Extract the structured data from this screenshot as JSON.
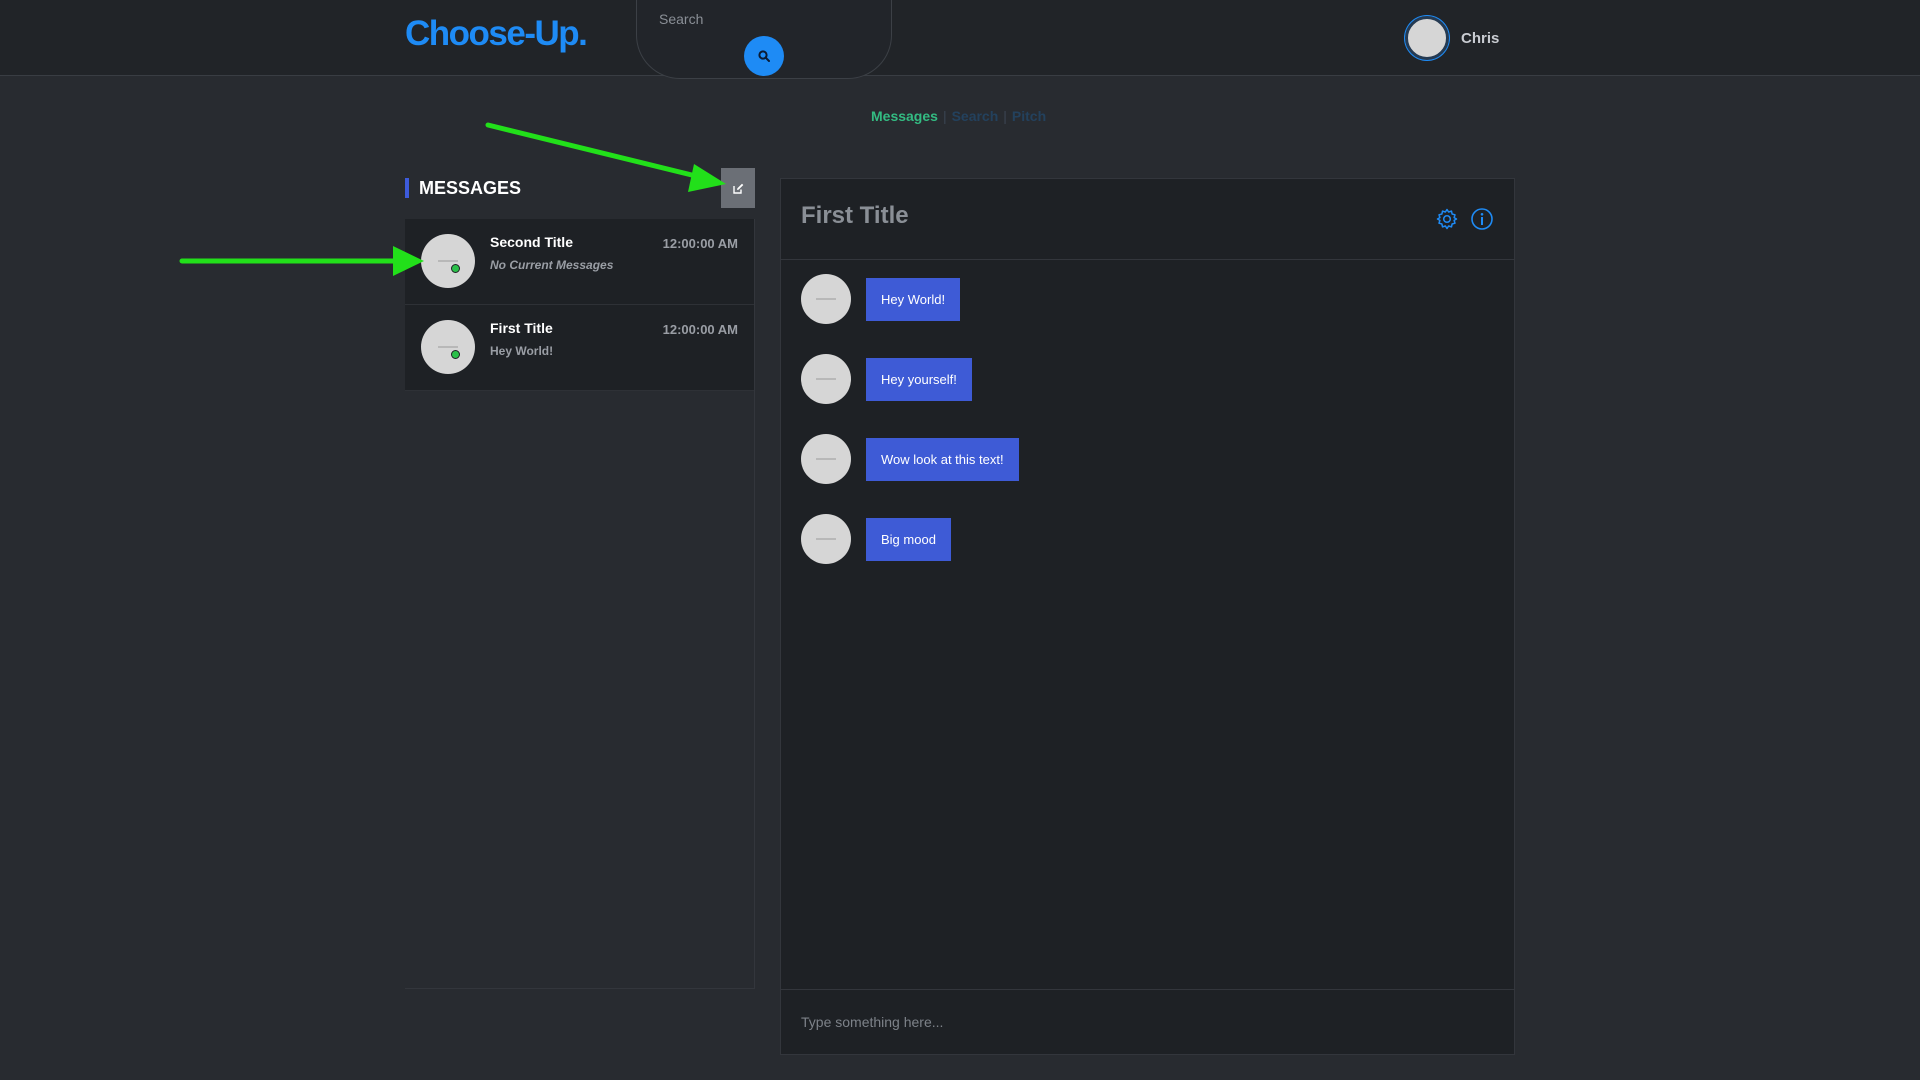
{
  "header": {
    "logo": "Choose-Up.",
    "search": {
      "placeholder": "Search",
      "icon": "search-icon"
    },
    "user": {
      "name": "Chris"
    }
  },
  "subnav": {
    "items": [
      {
        "label": "Messages",
        "active": true
      },
      {
        "label": "Search",
        "active": false
      },
      {
        "label": "Pitch",
        "active": false
      }
    ]
  },
  "messages_panel": {
    "heading": "MESSAGES",
    "compose_icon": "edit-icon",
    "conversations": [
      {
        "title": "Second Title",
        "preview": "No Current Messages",
        "time": "12:00:00 AM",
        "online": true
      },
      {
        "title": "First Title",
        "preview": "Hey World!",
        "time": "12:00:00 AM",
        "online": true
      }
    ]
  },
  "chat": {
    "title": "First Title",
    "icons": [
      "gear-icon",
      "info-icon"
    ],
    "messages": [
      {
        "text": "Hey World!"
      },
      {
        "text": "Hey yourself!"
      },
      {
        "text": "Wow look at this text!"
      },
      {
        "text": "Big mood"
      }
    ],
    "composer_placeholder": "Type something here..."
  },
  "colors": {
    "brand": "#1e8bf5",
    "active_nav": "#33bb82",
    "bubble": "#3e5bd6",
    "online": "#2bc04a",
    "annotation_arrow": "#22e01a"
  }
}
